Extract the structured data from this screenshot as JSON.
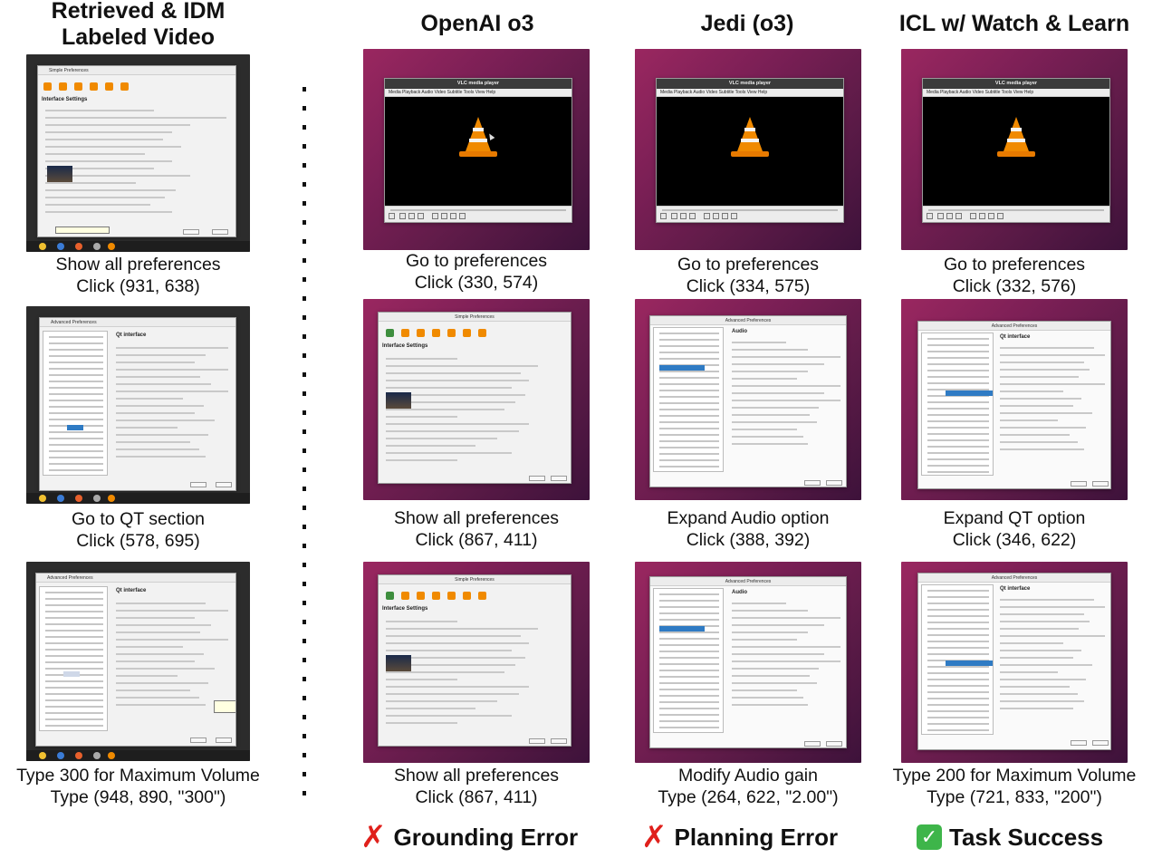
{
  "columns": [
    {
      "title_lines": [
        "Retrieved & IDM",
        "Labeled Video"
      ]
    },
    {
      "title_lines": [
        "OpenAI o3"
      ]
    },
    {
      "title_lines": [
        "Jedi (o3)"
      ]
    },
    {
      "title_lines": [
        "ICL w/ Watch & Learn"
      ]
    }
  ],
  "rows": [
    {
      "cells": [
        {
          "step": "Show all preferences",
          "action": "Click (931, 638)"
        },
        {
          "step": "Go to preferences",
          "action": "Click (330, 574)"
        },
        {
          "step": "Go to preferences",
          "action": "Click (334, 575)"
        },
        {
          "step": "Go to preferences",
          "action": "Click (332, 576)"
        }
      ]
    },
    {
      "cells": [
        {
          "step": "Go to QT section",
          "action": "Click (578, 695)"
        },
        {
          "step": "Show all preferences",
          "action": "Click (867, 411)"
        },
        {
          "step": "Expand Audio option",
          "action": "Click (388, 392)"
        },
        {
          "step": "Expand QT option",
          "action": "Click (346, 622)"
        }
      ]
    },
    {
      "cells": [
        {
          "step": "Type 300 for Maximum Volume",
          "action": "Type (948, 890, \"300\")"
        },
        {
          "step": "Show all preferences",
          "action": "Click (867, 411)"
        },
        {
          "step": "Modify Audio gain",
          "action": "Type (264, 622, \"2.00\")"
        },
        {
          "step": "Type 200 for Maximum Volume",
          "action": "Type (721, 833, \"200\")"
        }
      ]
    }
  ],
  "screenshots": {
    "vlc_window_title": "VLC media player",
    "vlc_menu": "Media  Playback  Audio  Video  Subtitle  Tools  View  Help",
    "simple_prefs_title": "Simple Preferences",
    "advanced_prefs_title": "Advanced Preferences",
    "interface_settings_heading": "Interface Settings",
    "qt_interface_heading": "Qt interface",
    "audio_heading": "Audio"
  },
  "verdicts": [
    {
      "column": 1,
      "icon": "cross-mark-icon",
      "label": "Grounding Error"
    },
    {
      "column": 2,
      "icon": "cross-mark-icon",
      "label": "Planning Error"
    },
    {
      "column": 3,
      "icon": "check-mark-icon",
      "label": "Task Success"
    }
  ],
  "colors": {
    "error_red": "#e0201b",
    "success_green": "#3eb54a",
    "ubuntu_bg": "#7a1f55",
    "vlc_orange": "#f08a00",
    "selection_blue": "#2f7bc4"
  }
}
